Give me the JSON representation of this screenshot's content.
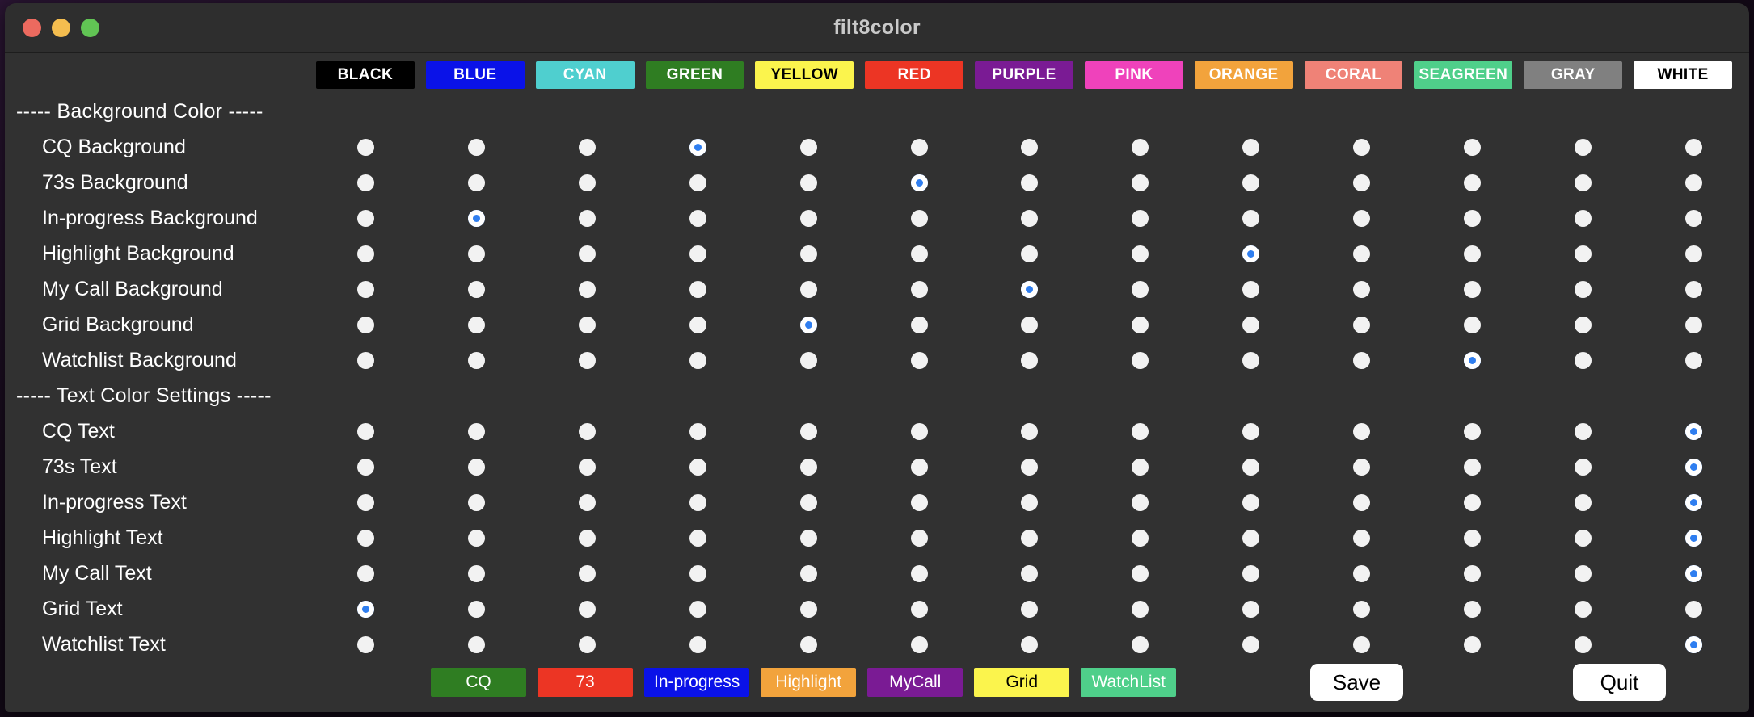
{
  "window": {
    "title": "filt8color",
    "traffic_lights": [
      {
        "name": "close-button",
        "color": "#ec6a5f"
      },
      {
        "name": "minimize-button",
        "color": "#f4bd4f"
      },
      {
        "name": "maximize-button",
        "color": "#61c454"
      }
    ]
  },
  "columns": [
    {
      "label": "BLACK",
      "bg": "#000000",
      "fg": "#ffffff"
    },
    {
      "label": "BLUE",
      "bg": "#0a12e8",
      "fg": "#ffffff"
    },
    {
      "label": "CYAN",
      "bg": "#4fcfcf",
      "fg": "#ffffff"
    },
    {
      "label": "GREEN",
      "bg": "#2f7d22",
      "fg": "#ffffff"
    },
    {
      "label": "YELLOW",
      "bg": "#fbf44d",
      "fg": "#000000"
    },
    {
      "label": "RED",
      "bg": "#ec3524",
      "fg": "#ffffff"
    },
    {
      "label": "PURPLE",
      "bg": "#7a1b94",
      "fg": "#ffffff"
    },
    {
      "label": "PINK",
      "bg": "#ef42bb",
      "fg": "#ffffff"
    },
    {
      "label": "ORANGE",
      "bg": "#f2a33c",
      "fg": "#ffffff"
    },
    {
      "label": "CORAL",
      "bg": "#ef8277",
      "fg": "#ffffff"
    },
    {
      "label": "SEAGREEN",
      "bg": "#4fcf8a",
      "fg": "#ffffff"
    },
    {
      "label": "GRAY",
      "bg": "#808080",
      "fg": "#ffffff"
    },
    {
      "label": "WHITE",
      "bg": "#ffffff",
      "fg": "#000000"
    }
  ],
  "sections": [
    {
      "heading": "----- Background Color -----",
      "rows": [
        {
          "label": "CQ Background",
          "selected_index": 3
        },
        {
          "label": "73s Background",
          "selected_index": 5
        },
        {
          "label": "In-progress Background",
          "selected_index": 1
        },
        {
          "label": "Highlight Background",
          "selected_index": 8
        },
        {
          "label": "My Call Background",
          "selected_index": 6
        },
        {
          "label": "Grid Background",
          "selected_index": 4
        },
        {
          "label": "Watchlist Background",
          "selected_index": 10
        }
      ]
    },
    {
      "heading": "----- Text Color Settings -----",
      "rows": [
        {
          "label": "CQ Text",
          "selected_index": 12
        },
        {
          "label": "73s Text",
          "selected_index": 12
        },
        {
          "label": "In-progress Text",
          "selected_index": 12
        },
        {
          "label": "Highlight Text",
          "selected_index": 12
        },
        {
          "label": "My Call Text",
          "selected_index": 12
        },
        {
          "label": "Grid Text",
          "selected_index": 0
        },
        {
          "label": "Watchlist Text",
          "selected_index": 12
        }
      ]
    }
  ],
  "previews": [
    {
      "label": "CQ",
      "bg": "#2f7d22",
      "fg": "#ffffff"
    },
    {
      "label": "73",
      "bg": "#ec3524",
      "fg": "#ffffff"
    },
    {
      "label": "In-progress",
      "bg": "#0a12e8",
      "fg": "#ffffff"
    },
    {
      "label": "Highlight",
      "bg": "#f2a33c",
      "fg": "#ffffff"
    },
    {
      "label": "MyCall",
      "bg": "#7a1b94",
      "fg": "#ffffff"
    },
    {
      "label": "Grid",
      "bg": "#fbf44d",
      "fg": "#000000"
    },
    {
      "label": "WatchList",
      "bg": "#4fcf8a",
      "fg": "#ffffff"
    }
  ],
  "actions": {
    "save_label": "Save",
    "quit_label": "Quit"
  },
  "theme": {
    "radio_selected": "#2f7ef0",
    "radio_unselected": "#f2f2f2",
    "panel_bg": "#313131",
    "titlebar_bg": "#2e2e2e"
  }
}
